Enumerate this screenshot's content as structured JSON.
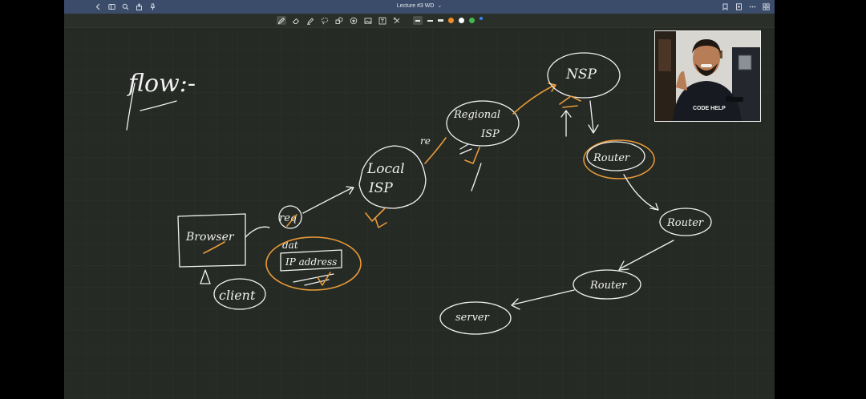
{
  "window": {
    "title": "Lecture #3 WD",
    "title_caret": "⌄"
  },
  "topbar_icons_left": [
    "back-chevron-icon",
    "sidebar-icon",
    "search-icon",
    "share-icon",
    "mic-icon"
  ],
  "topbar_icons_right": [
    "bookmark-icon",
    "add-page-icon",
    "more-icon",
    "grid-icon"
  ],
  "toolbar": {
    "tools": [
      "pen-icon",
      "eraser-icon",
      "highlighter-icon",
      "lasso-icon",
      "shapes-icon",
      "star-icon",
      "image-icon",
      "text-icon",
      "sticker-icon"
    ],
    "colors": [
      "#f28c28",
      "#ffffff",
      "#3fb950"
    ],
    "accent": "#3b82f6"
  },
  "notes": {
    "heading": "flow:-",
    "browser": "Browser",
    "client": "client",
    "req": "req",
    "dat": "dat",
    "ip_address": "IP address",
    "local_isp_line1": "Local",
    "local_isp_line2": "ISP",
    "re": "re",
    "regional_isp_line1": "Regional",
    "regional_isp_line2": "ISP",
    "nsp": "NSP",
    "router_1": "Router",
    "router_2": "Router",
    "router_3": "Router",
    "server": "server"
  },
  "webcam": {
    "shirt_text": "CODE HELP"
  },
  "colors": {
    "board": "#262a25",
    "ink": "#f2f2f2",
    "highlight": "#e89a38",
    "topbar": "#3b4c6a"
  }
}
